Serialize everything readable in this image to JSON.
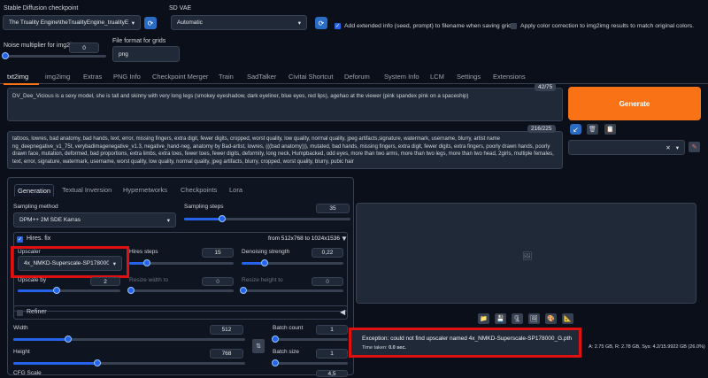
{
  "header": {
    "checkpoint_label": "Stable Diffusion checkpoint",
    "checkpoint_value": "The Truality Engine\\theTrualityEngine_trualityE",
    "vae_label": "SD VAE",
    "vae_value": "Automatic",
    "extended_info_label": "Add extended info (seed, prompt) to filename when saving grid",
    "color_correction_label": "Apply color correction to img2img results to match original colors.",
    "noise_label": "Noise multiplier for img2img",
    "noise_value": "0",
    "format_label": "File format for grids",
    "format_value": "png"
  },
  "tabs": [
    "txt2img",
    "img2img",
    "Extras",
    "PNG Info",
    "Checkpoint Merger",
    "Train",
    "SadTalker",
    "Civitai Shortcut",
    "Deforum",
    "System Info",
    "LCM",
    "Settings",
    "Extensions"
  ],
  "prompt": {
    "text": "DV_Dee_Vicious is a sexy model, she is tall and skinny with very long legs (smokey eyeshadow, dark eyeliner, blue eyes, red lips), agehao at the viewer (pink spandex pink on a spaceship)",
    "counter": "42/75"
  },
  "negative": {
    "text": "tattoos, lowres, bad anatomy, bad hands, text, error, missing fingers, extra digit, fewer digits, cropped, worst quality, low quality, normal quality, jpeg artifacts,signature, watermark, username, blurry, artist name ng_deepnegative_v1_75t, verybadimagenegative_v1.3, negative_hand-neg, anatomy by Bad-artist, lowres, (((bad anatomy))), mutated, bad hands, missing fingers, extra digit, fewer digits, extra fingers, poorly drawn hands, poorly drawn face, mutation, deformed, bad proportions, extra limbs, extra toes, fewer toes, fewer digits, deformity, long neck, Humpbacked, odd eyes, more than two arms, more than two legs, more than two head, 2girls, multiple females, text, error, signature, watermark, username, worst quality, low quality, normal quality, jpeg artifacts, blurry, cropped, worst quality, blurry, pubic hair",
    "counter": "216/225"
  },
  "generate_label": "Generate",
  "subtabs": [
    "Generation",
    "Textual Inversion",
    "Hypernetworks",
    "Checkpoints",
    "Lora"
  ],
  "sampling": {
    "method_label": "Sampling method",
    "method_value": "DPM++ 2M SDE Karras",
    "steps_label": "Sampling steps",
    "steps_value": "35",
    "steps_fraction": 0.23
  },
  "hires": {
    "label": "Hires. fix",
    "range_text": "from 512x768 to 1024x1536",
    "upscaler_label": "Upscaler",
    "upscaler_value": "4x_NMKD-Superscale-SP178000_(",
    "hires_steps_label": "Hires steps",
    "hires_steps_value": "15",
    "denoise_label": "Denoising strength",
    "denoise_value": "0,22",
    "upscale_by_label": "Upscale by",
    "upscale_by_value": "2",
    "resize_w_label": "Resize width to",
    "resize_w_value": "0",
    "resize_h_label": "Resize height to",
    "resize_h_value": "0"
  },
  "refiner_label": "Refiner",
  "size": {
    "width_label": "Width",
    "width_value": "512",
    "height_label": "Height",
    "height_value": "768",
    "batch_count_label": "Batch count",
    "batch_count_value": "1",
    "batch_size_label": "Batch size",
    "batch_size_value": "1",
    "cfg_label": "CFG Scale",
    "cfg_value": "4,5",
    "swap_icon": "swap-icon"
  },
  "output": {
    "error_text": "Exception: could not find upscaler named 4x_NMKD-Superscale-SP178000_G.pth",
    "time_label": "Time taken: ",
    "time_value": "0.0 sec.",
    "vram_text": "A: 2.75 GB, R: 2.78 GB, Sys: 4.2/15.9922 GB (26.0%)"
  },
  "colors": {
    "accent": "#2563eb",
    "generate": "#f97316",
    "highlight_box": "#e11010"
  }
}
